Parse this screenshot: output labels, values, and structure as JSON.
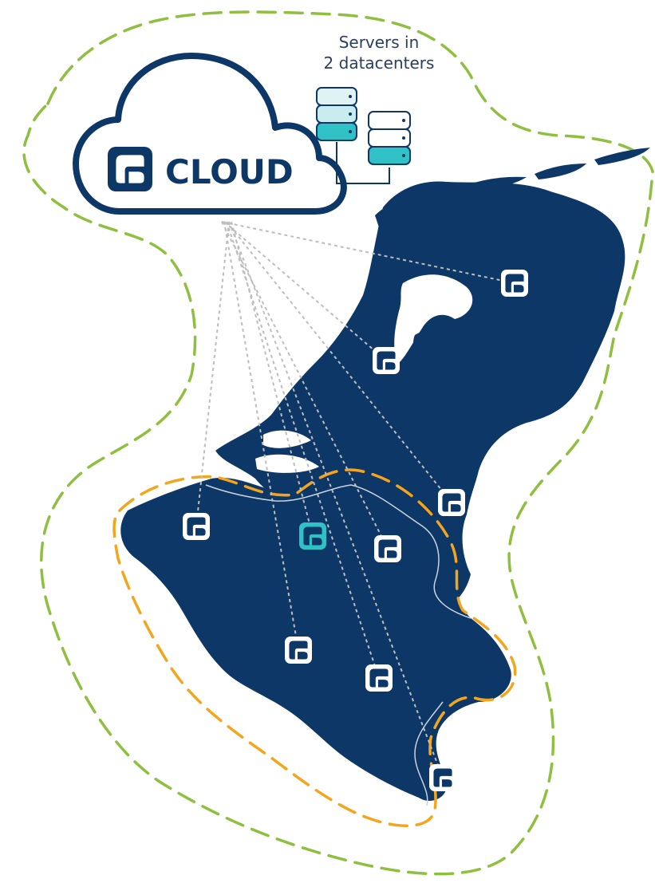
{
  "servers_caption": {
    "line1": "Servers in",
    "line2": "2 datacenters"
  },
  "cloud": {
    "label": "CLOUD",
    "icon": "cloud-logo-icon"
  },
  "colors": {
    "region_fill": "#0d3766",
    "cloud_outline": "#0d3766",
    "teal_accent": "#2fc1c5",
    "green_boundary": "#8fbf3f",
    "orange_boundary": "#f3a51d",
    "connector_line": "#bdbdbd",
    "node_icon_fill": "#ffffff"
  },
  "server_stacks": [
    {
      "icon": "server-stack-icon",
      "fill": "light-teal"
    },
    {
      "icon": "server-stack-icon",
      "fill": "white-teal"
    }
  ],
  "nodes": [
    {
      "icon": "node-logo-icon",
      "highlight": false
    },
    {
      "icon": "node-logo-icon",
      "highlight": false
    },
    {
      "icon": "node-logo-icon",
      "highlight": false
    },
    {
      "icon": "node-logo-icon",
      "highlight": false
    },
    {
      "icon": "node-logo-icon",
      "highlight": true
    },
    {
      "icon": "node-logo-icon",
      "highlight": false
    },
    {
      "icon": "node-logo-icon",
      "highlight": false
    },
    {
      "icon": "node-logo-icon",
      "highlight": false
    },
    {
      "icon": "node-logo-icon",
      "highlight": false
    }
  ]
}
